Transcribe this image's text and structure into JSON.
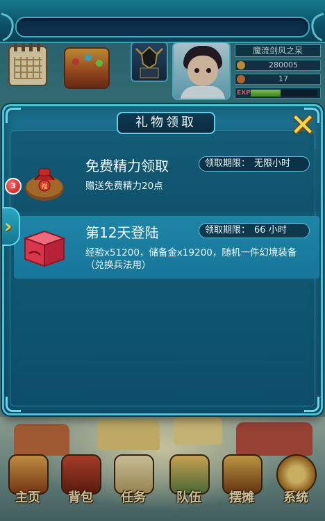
{
  "player": {
    "name": "魔流剑风之呆",
    "silver": "280005",
    "energy": "17",
    "exp_label": "EXP",
    "exp_progress": 0.45
  },
  "dialog": {
    "title": "礼物领取",
    "badge_count": "3",
    "side_tab_icon": "chevron-right-icon",
    "close_icon": "close-x-icon",
    "gifts": [
      {
        "name": "免费精力领取",
        "deadline_label": "领取期限：",
        "deadline_value": "无限小时",
        "description": "赠送免费精力20点",
        "icon": "energy-jar-icon",
        "selected": false
      },
      {
        "name": "第12天登陆",
        "deadline_label": "领取期限：",
        "deadline_value": "66  小时",
        "description": "经验x51200，储备金x19200，随机一件幻境装备（兑换兵法用）",
        "icon": "red-gift-box-icon",
        "selected": true
      }
    ]
  },
  "nav": [
    {
      "label": "主页",
      "icon": "home-house-icon"
    },
    {
      "label": "背包",
      "icon": "backpack-chest-icon"
    },
    {
      "label": "任务",
      "icon": "quest-scroll-icon"
    },
    {
      "label": "队伍",
      "icon": "team-people-icon"
    },
    {
      "label": "摆摊",
      "icon": "stall-shop-icon"
    },
    {
      "label": "系统",
      "icon": "system-gear-icon"
    }
  ],
  "colors": {
    "dialog_bg": "#156583",
    "dialog_border": "#41c6dc",
    "accent_gold": "#f7d64a",
    "badge_red": "#c41010",
    "selected_row": "#1e85a6"
  }
}
